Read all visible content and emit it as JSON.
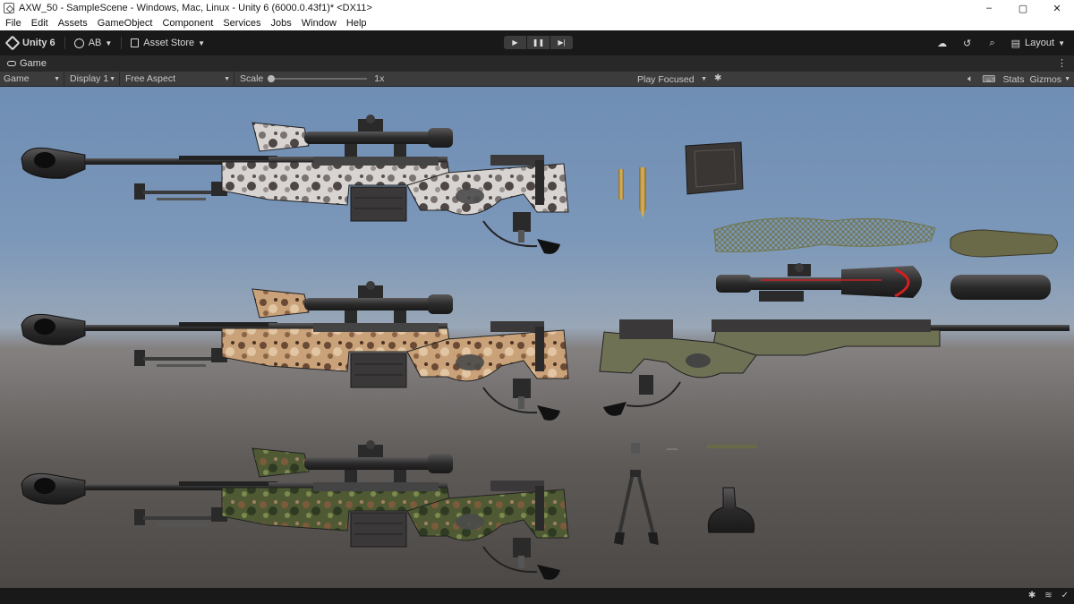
{
  "window": {
    "title": "AXW_50 - SampleScene - Windows, Mac, Linux - Unity 6 (6000.0.43f1)* <DX11>",
    "controls": [
      "–",
      "▢",
      "✕"
    ]
  },
  "menu": [
    "File",
    "Edit",
    "Assets",
    "GameObject",
    "Component",
    "Services",
    "Jobs",
    "Window",
    "Help"
  ],
  "toolbar": {
    "unity_label": "Unity 6",
    "account_label": "AB",
    "asset_store_label": "Asset Store",
    "layout_label": "Layout",
    "play_icon": "▶",
    "pause_icon": "❚❚",
    "step_icon": "▶|"
  },
  "tab": {
    "label": "Game"
  },
  "game_toolbar": {
    "mode": "Game",
    "display": "Display 1",
    "aspect": "Free Aspect",
    "scale_label": "Scale",
    "scale_value": "1x",
    "play_mode": "Play Focused",
    "stats_label": "Stats",
    "gizmos_label": "Gizmos"
  },
  "icons": {
    "cloud": "cloud-icon",
    "history": "history-icon",
    "search": "search-icon",
    "audio": "audio-icon",
    "keyboard": "keyboard-icon",
    "bug": "bug-icon"
  }
}
